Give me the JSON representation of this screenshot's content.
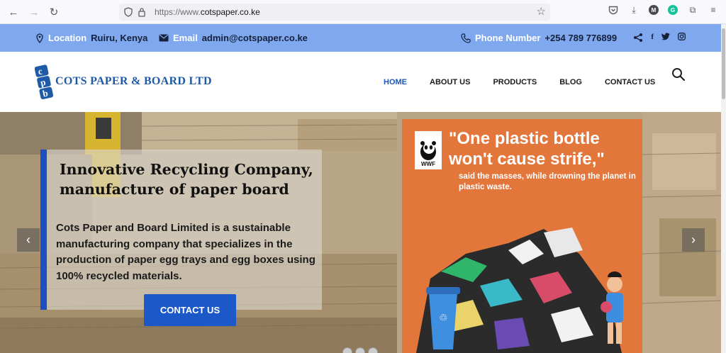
{
  "browser": {
    "url_prefix": "https://www.",
    "url_domain": "cotspaper.co.ke",
    "profile_initial": "M",
    "grammarly_initial": "G"
  },
  "topbar": {
    "location_label": "Location",
    "location_value": "Ruiru, Kenya",
    "email_label": "Email",
    "email_value": "admin@cotspaper.co.ke",
    "phone_label": "Phone Number",
    "phone_value": "+254 789 776899"
  },
  "header": {
    "logo_letters": "cpb",
    "company_name": "COTS PAPER & BOARD LTD",
    "nav": [
      "HOME",
      "ABOUT US",
      "PRODUCTS",
      "BLOG",
      "CONTACT US"
    ]
  },
  "hero": {
    "title": "Innovative Recycling Company, manufacture of paper board",
    "description": "Cots Paper and Board Limited is a sustainable manufacturing company that specializes in the production of paper egg trays and egg boxes using 100% recycled materials.",
    "cta_label": "CONTACT US",
    "prev_arrow": "‹",
    "next_arrow": "›"
  },
  "poster": {
    "brand": "WWF",
    "quote": "\"One plastic bottle won't cause strife,\"",
    "subtext": "said the masses, while drowning the planet in plastic waste."
  },
  "colors": {
    "topbar": "#7fa8ef",
    "accent_blue": "#1c58c7",
    "poster_orange": "#e2763b"
  }
}
